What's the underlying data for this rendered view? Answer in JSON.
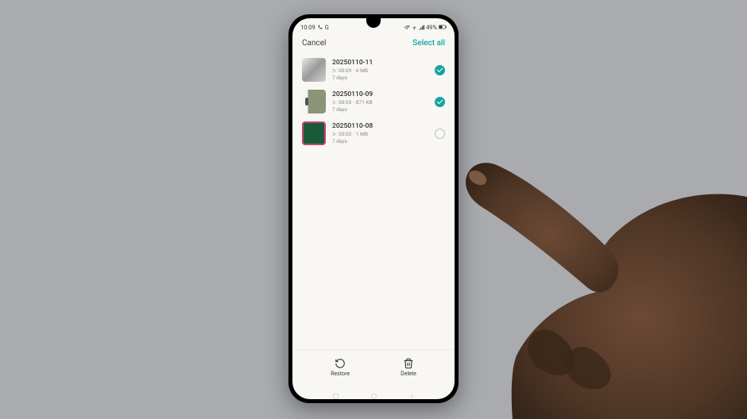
{
  "status": {
    "time": "10:09",
    "carrier": "G",
    "battery": "49%"
  },
  "header": {
    "cancel": "Cancel",
    "select_all": "Select all"
  },
  "items": [
    {
      "title": "20250110-11",
      "duration": "00:09",
      "size": "6 MB",
      "days": "7 days",
      "checked": true
    },
    {
      "title": "20250110-09",
      "duration": "00:03",
      "size": "871 KB",
      "days": "7 days",
      "checked": true
    },
    {
      "title": "20250110-08",
      "duration": "00:03",
      "size": "1 MB",
      "days": "7 days",
      "checked": false
    }
  ],
  "footer": {
    "restore": "Restore",
    "delete": "Delete"
  },
  "colors": {
    "accent": "#1aa3a0",
    "bg": "#f8f7f3"
  }
}
